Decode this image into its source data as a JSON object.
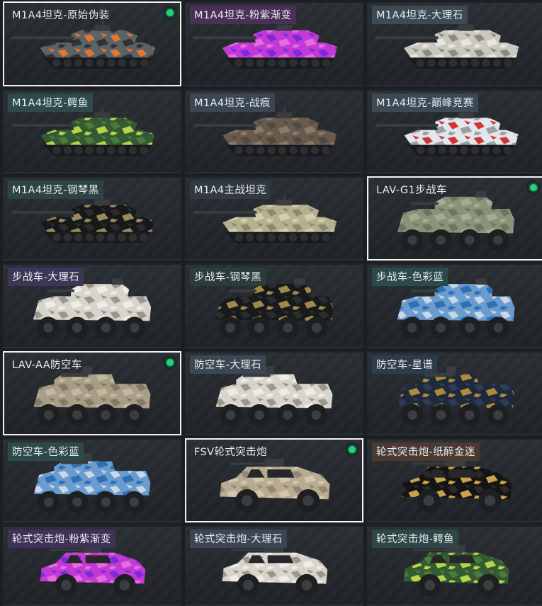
{
  "skins": [
    {
      "label": "M1A4坦克-原始伪装",
      "type": "tank",
      "equipped": true,
      "tag_color": "#3b4f5c",
      "colors": [
        "#5b6268",
        "#e8762a",
        "#2d3237"
      ]
    },
    {
      "label": "M1A4坦克-粉紫渐变",
      "type": "tank",
      "equipped": false,
      "tag_color": "#4b2f57",
      "colors": [
        "#c13ad6",
        "#7a2ad9",
        "#e56be0"
      ]
    },
    {
      "label": "M1A4坦克-大理石",
      "type": "tank",
      "equipped": false,
      "tag_color": "#3c4a56",
      "colors": [
        "#c9c8c0",
        "#8c8a80",
        "#e9e6dc"
      ]
    },
    {
      "label": "M1A4坦克-鳄鱼",
      "type": "tank",
      "equipped": false,
      "tag_color": "#2f4a4b",
      "colors": [
        "#335a32",
        "#4c7a3a",
        "#b6d44b"
      ]
    },
    {
      "label": "M1A4坦克-战痕",
      "type": "tank",
      "equipped": false,
      "tag_color": "#3a4651",
      "colors": [
        "#6a5a4e",
        "#4d4a44",
        "#8a7a66"
      ]
    },
    {
      "label": "M1A4坦克-巅峰竞赛",
      "type": "tank",
      "equipped": false,
      "tag_color": "#3c4a55",
      "colors": [
        "#e3e6ea",
        "#d23236",
        "#9aa0a6"
      ]
    },
    {
      "label": "M1A4坦克-钢琴黑",
      "type": "tank",
      "equipped": false,
      "tag_color": "#2e4343",
      "colors": [
        "#171819",
        "#2a2b2d",
        "#9a8a5a"
      ]
    },
    {
      "label": "M1A4主战坦克",
      "type": "tank",
      "equipped": false,
      "tag_color": "#323a41",
      "colors": [
        "#b5b090",
        "#8c8a6e",
        "#d2cfb0"
      ]
    },
    {
      "label": "LAV-G1步战车",
      "type": "apc",
      "equipped": true,
      "tag_color": "#323a41",
      "colors": [
        "#8a9278",
        "#6d7560",
        "#a5ac95"
      ]
    },
    {
      "label": "步战车-大理石",
      "type": "apc",
      "equipped": false,
      "tag_color": "#3d3656",
      "colors": [
        "#d6d4cc",
        "#9a968a",
        "#efece4"
      ]
    },
    {
      "label": "步战车-钢琴黑",
      "type": "apc",
      "equipped": false,
      "tag_color": "#2b3c3b",
      "colors": [
        "#18191a",
        "#2b2c2e",
        "#a08a4a"
      ]
    },
    {
      "label": "步战车-色彩蓝",
      "type": "apc",
      "equipped": false,
      "tag_color": "#2c4a4c",
      "colors": [
        "#6b9ccf",
        "#c9d8e6",
        "#2f6fb3"
      ]
    },
    {
      "label": "LAV-AA防空车",
      "type": "aa",
      "equipped": true,
      "tag_color": "#323a41",
      "colors": [
        "#a89e86",
        "#847b66",
        "#c3b9a0"
      ]
    },
    {
      "label": "防空车-大理石",
      "type": "aa",
      "equipped": false,
      "tag_color": "#3b4752",
      "colors": [
        "#d6d4cc",
        "#9a968a",
        "#efece4"
      ]
    },
    {
      "label": "防空车-星谱",
      "type": "aa",
      "equipped": false,
      "tag_color": "#2d3b4c",
      "colors": [
        "#1e2a3c",
        "#2e3d55",
        "#b08a3a"
      ]
    },
    {
      "label": "防空车-色彩蓝",
      "type": "aa",
      "equipped": false,
      "tag_color": "#2d4a4a",
      "colors": [
        "#6b9ccf",
        "#c9d8e6",
        "#2f6fb3"
      ]
    },
    {
      "label": "FSV轮式突击炮",
      "type": "fsv",
      "equipped": true,
      "tag_color": "#323a41",
      "colors": [
        "#b9ab92",
        "#948672",
        "#d2c6ae"
      ]
    },
    {
      "label": "轮式突击炮-纸醉金迷",
      "type": "fsv",
      "equipped": false,
      "tag_color": "#4a3a32",
      "colors": [
        "#141414",
        "#2a2a2a",
        "#c9a24a"
      ]
    },
    {
      "label": "轮式突击炮-粉紫渐变",
      "type": "fsv",
      "equipped": false,
      "tag_color": "#3e3256",
      "colors": [
        "#c13ad6",
        "#7a2ad9",
        "#e56be0"
      ]
    },
    {
      "label": "轮式突击炮-大理石",
      "type": "fsv",
      "equipped": false,
      "tag_color": "#3b4652",
      "colors": [
        "#d6d4cc",
        "#9a968a",
        "#efece4"
      ]
    },
    {
      "label": "轮式突击炮-鳄鱼",
      "type": "fsv",
      "equipped": false,
      "tag_color": "#2d4646",
      "colors": [
        "#335a32",
        "#4c7a3a",
        "#b6d44b"
      ]
    }
  ]
}
